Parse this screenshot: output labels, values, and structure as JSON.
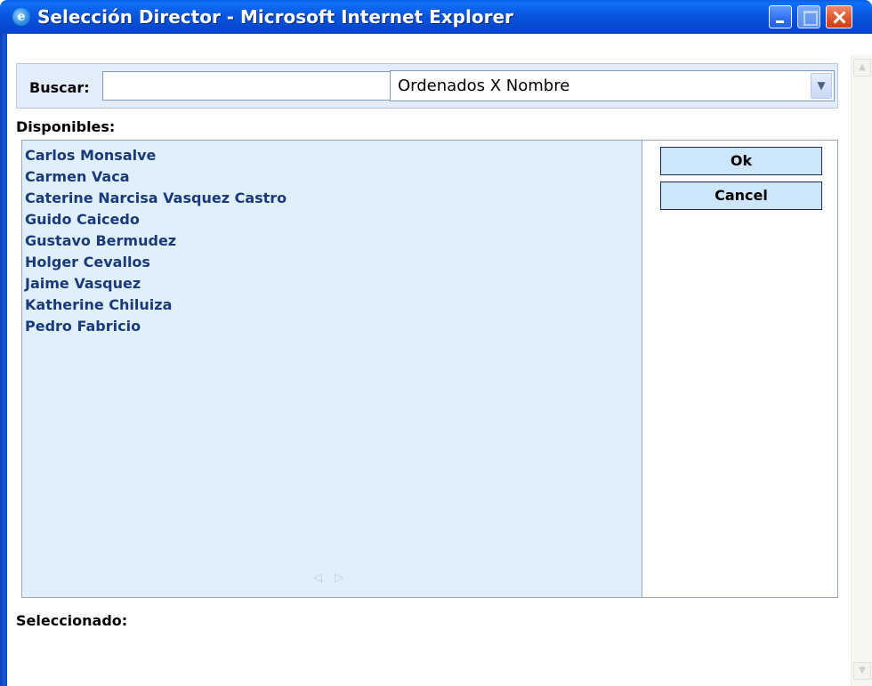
{
  "window": {
    "title": "Selección Director - Microsoft Internet Explorer"
  },
  "search": {
    "label": "Buscar:",
    "value": "",
    "sort_selected": "Ordenados X Nombre"
  },
  "available": {
    "label": "Disponibles:",
    "items": [
      "Carlos Monsalve",
      "Carmen Vaca",
      "Caterine Narcisa Vasquez Castro",
      "Guido Caicedo",
      "Gustavo Bermudez",
      "Holger Cevallos",
      "Jaime Vasquez",
      "Katherine Chiluiza",
      "Pedro Fabricio"
    ]
  },
  "buttons": {
    "ok": "Ok",
    "cancel": "Cancel"
  },
  "selected": {
    "label": "Seleccionado:"
  },
  "icons": {
    "window": "ie-icon",
    "minimize": "minimize-icon",
    "maximize": "maximize-icon",
    "close": "close-icon",
    "dropdown": "chevron-down-icon",
    "scroll_left": "arrow-left-icon",
    "scroll_right": "arrow-right-icon",
    "scroll_up": "arrow-up-icon",
    "scroll_down": "arrow-down-icon"
  }
}
